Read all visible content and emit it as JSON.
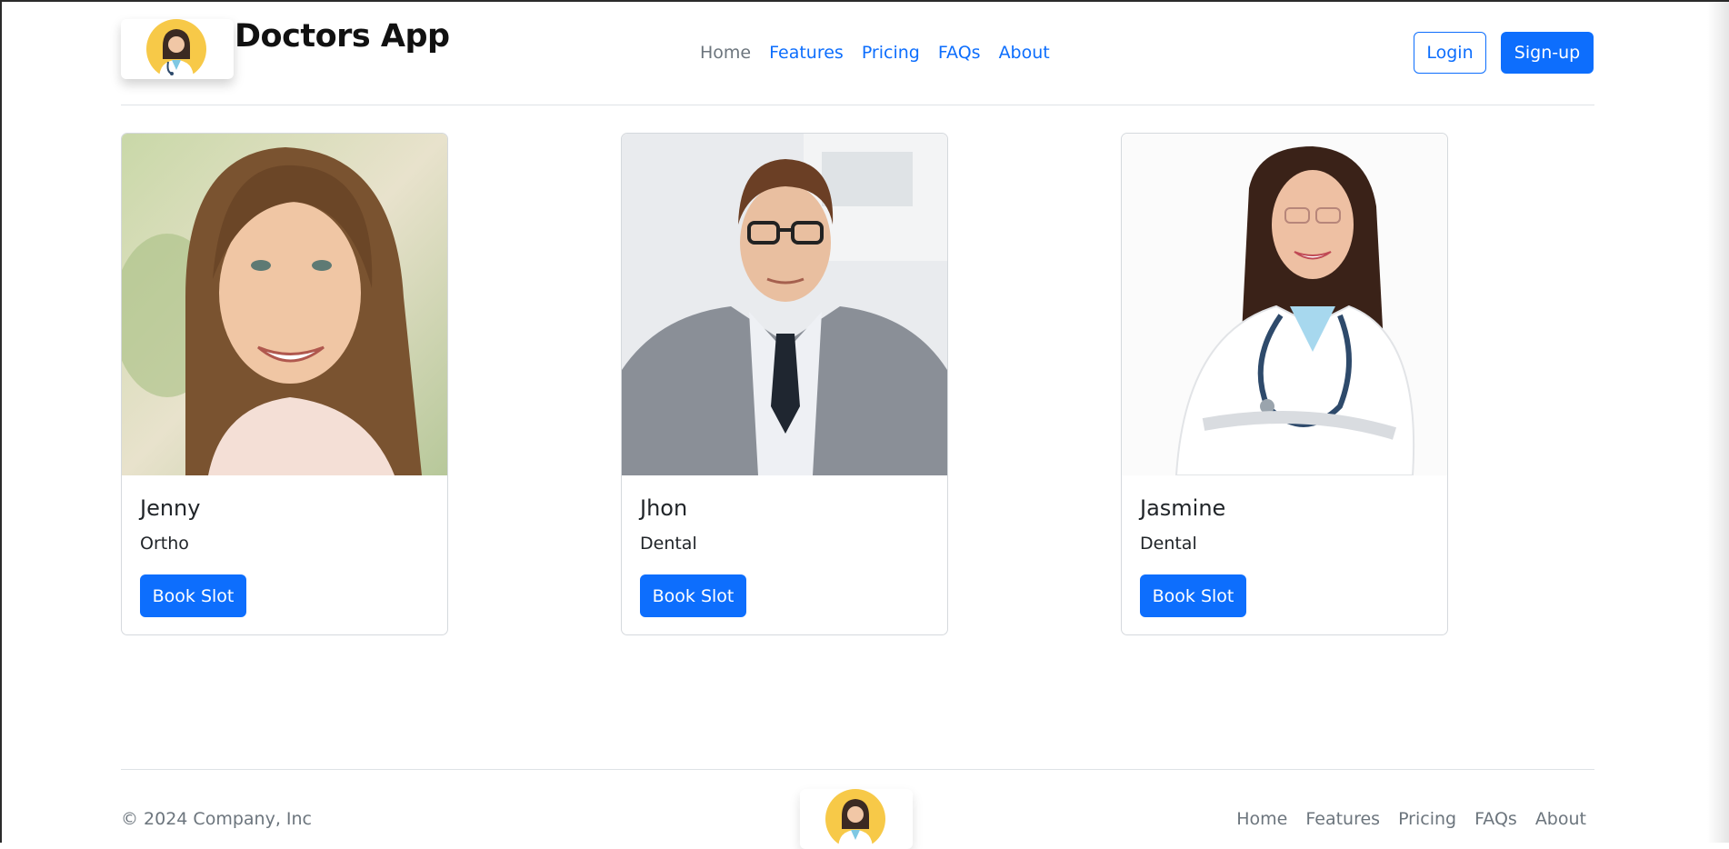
{
  "header": {
    "brand": "Doctors App",
    "nav": [
      {
        "label": "Home",
        "active": true
      },
      {
        "label": "Features",
        "active": false
      },
      {
        "label": "Pricing",
        "active": false
      },
      {
        "label": "FAQs",
        "active": false
      },
      {
        "label": "About",
        "active": false
      }
    ],
    "login_label": "Login",
    "signup_label": "Sign-up"
  },
  "doctors": [
    {
      "name": "Jenny",
      "specialty": "Ortho",
      "button": "Book Slot"
    },
    {
      "name": "Jhon",
      "specialty": "Dental",
      "button": "Book Slot"
    },
    {
      "name": "Jasmine",
      "specialty": "Dental",
      "button": "Book Slot"
    }
  ],
  "footer": {
    "copyright": "© 2024 Company, Inc",
    "nav": [
      "Home",
      "Features",
      "Pricing",
      "FAQs",
      "About"
    ]
  },
  "colors": {
    "primary": "#0d6efd",
    "muted": "#6c757d",
    "logo_yellow": "#f7c948"
  }
}
